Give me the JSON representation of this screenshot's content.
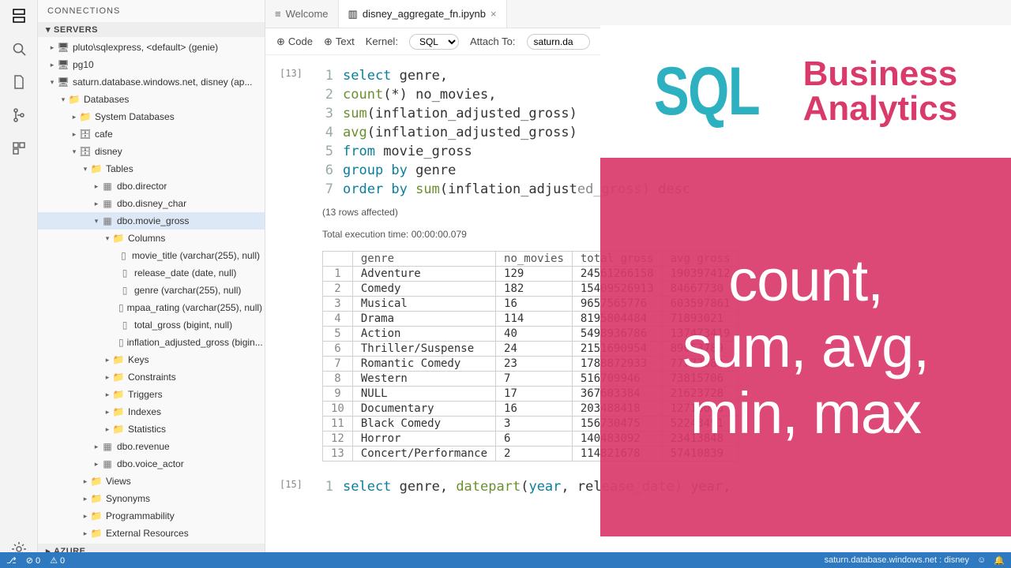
{
  "sidebar": {
    "title": "CONNECTIONS",
    "sections": {
      "servers": "SERVERS",
      "azure": "AZURE"
    },
    "servers": [
      {
        "label": "pluto\\sqlexpress, <default> (genie)"
      },
      {
        "label": "pg10"
      },
      {
        "label": "saturn.database.windows.net, disney (ap..."
      }
    ],
    "nodes": {
      "databases": "Databases",
      "system_db": "System Databases",
      "cafe": "cafe",
      "disney": "disney",
      "tables": "Tables",
      "t_director": "dbo.director",
      "t_disney_char": "dbo.disney_char",
      "t_movie_gross": "dbo.movie_gross",
      "columns": "Columns",
      "c_movie_title": "movie_title (varchar(255), null)",
      "c_release_date": "release_date (date, null)",
      "c_genre": "genre (varchar(255), null)",
      "c_mpaa": "mpaa_rating (varchar(255), null)",
      "c_total_gross": "total_gross (bigint, null)",
      "c_inflation": "inflation_adjusted_gross (bigin...",
      "keys": "Keys",
      "constraints": "Constraints",
      "triggers": "Triggers",
      "indexes": "Indexes",
      "statistics": "Statistics",
      "t_revenue": "dbo.revenue",
      "t_voice_actor": "dbo.voice_actor",
      "views": "Views",
      "synonyms": "Synonyms",
      "programmability": "Programmability",
      "external_resources": "External Resources"
    }
  },
  "tabs": [
    {
      "label": "Welcome",
      "active": false
    },
    {
      "label": "disney_aggregate_fn.ipynb",
      "active": true
    }
  ],
  "toolbar": {
    "code": "Code",
    "text": "Text",
    "kernel_label": "Kernel:",
    "kernel_value": "SQL",
    "attach_label": "Attach To:",
    "attach_value": "saturn.da"
  },
  "cell": {
    "prompt": "[13]",
    "lines": [
      [
        {
          "t": "select ",
          "c": "kw"
        },
        {
          "t": "genre,",
          "c": ""
        }
      ],
      [
        {
          "t": "count",
          "c": "fn"
        },
        {
          "t": "(*) no_movies,",
          "c": ""
        }
      ],
      [
        {
          "t": "sum",
          "c": "fn"
        },
        {
          "t": "(inflation_adjusted_gross)",
          "c": ""
        }
      ],
      [
        {
          "t": "avg",
          "c": "fn"
        },
        {
          "t": "(inflation_adjusted_gross)",
          "c": ""
        }
      ],
      [
        {
          "t": "from ",
          "c": "kw"
        },
        {
          "t": "movie_gross",
          "c": ""
        }
      ],
      [
        {
          "t": "group by ",
          "c": "kw"
        },
        {
          "t": "genre",
          "c": ""
        }
      ],
      [
        {
          "t": "order by ",
          "c": "kw"
        },
        {
          "t": "sum",
          "c": "fn"
        },
        {
          "t": "(inflation_adjust",
          "c": ""
        },
        {
          "t": "ed_gross) ",
          "c": "op"
        },
        {
          "t": "desc",
          "c": "str"
        }
      ]
    ],
    "rows_affected": "(13 rows affected)",
    "exec_time": "Total execution time: 00:00:00.079"
  },
  "result": {
    "headers": [
      "",
      "genre",
      "no_movies",
      "total gross",
      "avg gross"
    ],
    "rows": [
      [
        "1",
        "Adventure",
        "129",
        "24561266158",
        "190397412"
      ],
      [
        "2",
        "Comedy",
        "182",
        "15409526913",
        "84667730"
      ],
      [
        "3",
        "Musical",
        "16",
        "9657565776",
        "603597861"
      ],
      [
        "4",
        "Drama",
        "114",
        "8195804484",
        "71893021"
      ],
      [
        "5",
        "Action",
        "40",
        "5498936786",
        "137473419"
      ],
      [
        "6",
        "Thriller/Suspense",
        "24",
        "2151690954",
        "89653789"
      ],
      [
        "7",
        "Romantic Comedy",
        "23",
        "1788872933",
        "77777084"
      ],
      [
        "8",
        "Western",
        "7",
        "516709946",
        "73815706"
      ],
      [
        "9",
        "NULL",
        "17",
        "367603384",
        "21623728"
      ],
      [
        "10",
        "Documentary",
        "16",
        "203488418",
        "12718026"
      ],
      [
        "11",
        "Black Comedy",
        "3",
        "156730475",
        "52243491"
      ],
      [
        "12",
        "Horror",
        "6",
        "140483092",
        "23413848"
      ],
      [
        "13",
        "Concert/Performance",
        "2",
        "114821678",
        "57410839"
      ]
    ]
  },
  "next_cell": {
    "prompt": "[15]",
    "tokens": [
      {
        "t": "select ",
        "c": "kw"
      },
      {
        "t": "genre, ",
        "c": ""
      },
      {
        "t": "datepart",
        "c": "fn"
      },
      {
        "t": "(",
        "c": ""
      },
      {
        "t": "year",
        "c": "kw"
      },
      {
        "t": ", rel",
        "c": ""
      },
      {
        "t": "ease_date) ",
        "c": "op"
      },
      {
        "t": "year",
        "c": "kw"
      },
      {
        "t": ",",
        "c": ""
      }
    ]
  },
  "statusbar": {
    "branch": "⎇",
    "errors": "⊘ 0",
    "warnings": "⚠ 0",
    "conn": "saturn.database.windows.net : disney",
    "smile": "☺",
    "bell": "🔔"
  },
  "overlay": {
    "sql": "SQL",
    "ba1": "Business",
    "ba2": "Analytics",
    "big": "count,\nsum, avg,\nmin, max"
  }
}
